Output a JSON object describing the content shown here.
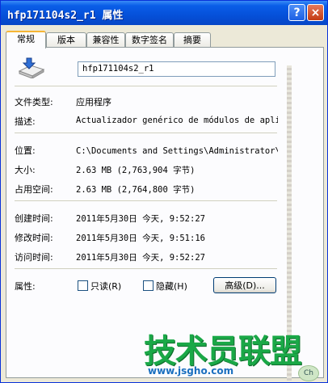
{
  "window": {
    "title": "hfp171104s2_r1 属性",
    "help_label": "?",
    "close_label": "×"
  },
  "tabs": [
    {
      "label": "常规",
      "active": true
    },
    {
      "label": "版本",
      "active": false
    },
    {
      "label": "兼容性",
      "active": false
    },
    {
      "label": "数字签名",
      "active": false
    },
    {
      "label": "摘要",
      "active": false
    }
  ],
  "general": {
    "icon": "application-icon",
    "file_name": "hfp171104s2_r1",
    "fields": {
      "type": {
        "label": "文件类型:",
        "value": "应用程序"
      },
      "description": {
        "label": "描述:",
        "value": "Actualizador genérico de módulos de aplic"
      },
      "location": {
        "label": "位置:",
        "value": "C:\\Documents and Settings\\Administrator\\桌"
      },
      "size": {
        "label": "大小:",
        "value": "2.63 MB (2,763,904 字节)"
      },
      "size_on_disk": {
        "label": "占用空间:",
        "value": "2.63 MB (2,764,800 字节)"
      },
      "created": {
        "label": "创建时间:",
        "value": "2011年5月30日 今天, 9:52:27"
      },
      "modified": {
        "label": "修改时间:",
        "value": "2011年5月30日 今天, 9:51:16"
      },
      "accessed": {
        "label": "访问时间:",
        "value": "2011年5月30日 今天, 9:52:27"
      }
    },
    "attributes": {
      "label": "属性:",
      "readonly_label": "只读(R)",
      "readonly_checked": false,
      "hidden_label": "隐藏(H)",
      "hidden_checked": false,
      "advanced_label": "高级(D)..."
    }
  },
  "watermark": {
    "text": "技术员联盟",
    "url": "www.jsgho.com",
    "corner_badge": "Ch"
  }
}
